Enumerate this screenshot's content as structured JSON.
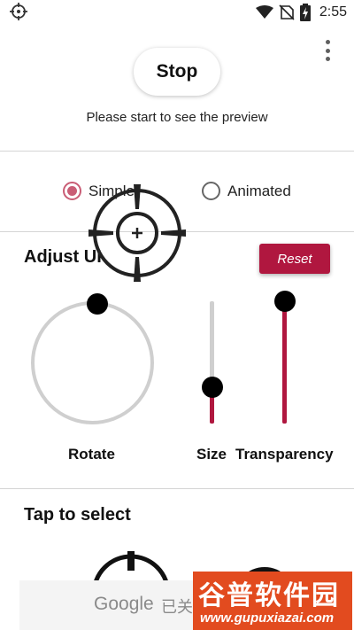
{
  "status_bar": {
    "time": "2:55",
    "left_icon": "crosshair-icon",
    "right_icons": [
      "wifi-icon",
      "no-sim-icon",
      "battery-charging-icon"
    ]
  },
  "header": {
    "stop_label": "Stop",
    "preview_hint": "Please start to see the preview",
    "menu_icon": "more-vert-icon"
  },
  "mode": {
    "options": [
      {
        "label": "Simple",
        "selected": true
      },
      {
        "label": "Animated",
        "selected": false
      }
    ]
  },
  "adjust": {
    "title": "Adjust UI",
    "reset_label": "Reset",
    "rotate_label": "Rotate",
    "size_label": "Size",
    "transparency_label": "Transparency",
    "size_level": 0.3,
    "transparency_level": 1.0
  },
  "select": {
    "title": "Tap to select"
  },
  "ad": {
    "brand": "Google",
    "text": "已关"
  },
  "watermark": {
    "text": "谷普软件园",
    "url": "www.gupuxiazai.com"
  },
  "colors": {
    "accent": "#b0173f",
    "radio_selected": "#c95d75",
    "track": "#cfcfcf",
    "watermark_bg": "#e24b1f"
  }
}
